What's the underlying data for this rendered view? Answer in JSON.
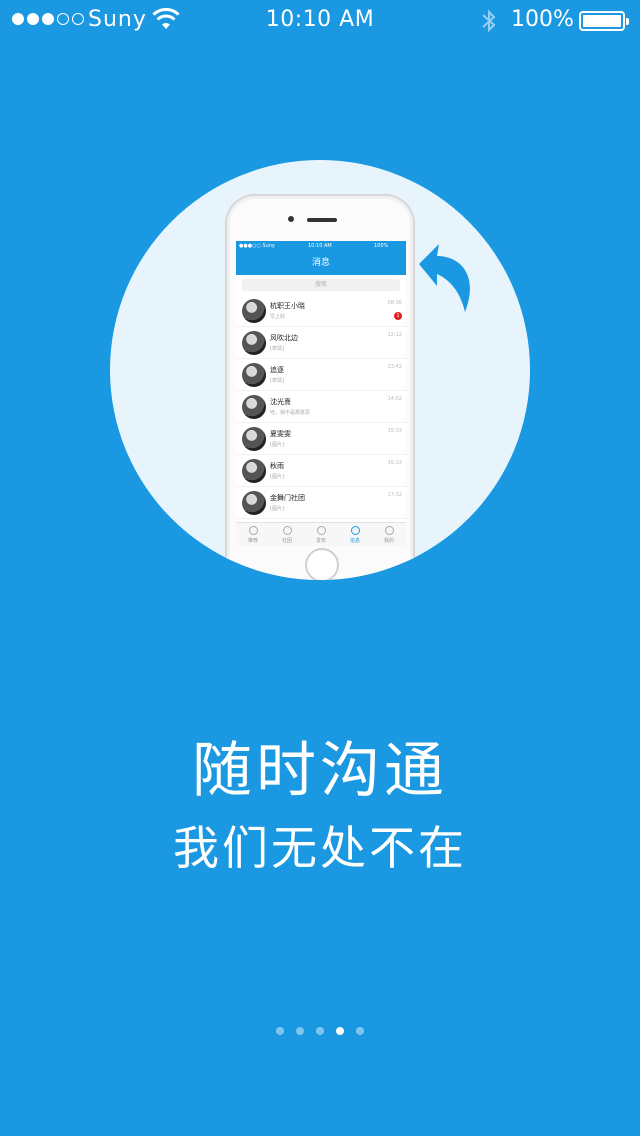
{
  "colors": {
    "background": "#1a98e1",
    "circle": "#e7f4fb",
    "text": "#ffffff",
    "badge": "#e02020"
  },
  "status_bar": {
    "signal_dots_filled": 3,
    "signal_dots_total": 5,
    "carrier": "Suny",
    "time": "10:10 AM",
    "battery_percent": "100%",
    "icons": [
      "wifi-icon",
      "bluetooth-icon",
      "battery-icon"
    ]
  },
  "illustration": {
    "arrow_icon": "curved-back-arrow-icon",
    "mock_screen": {
      "status": {
        "carrier": "●●●○○ Suny",
        "time": "10:10 AM",
        "battery": "100%"
      },
      "title": "消息",
      "search_placeholder": "搜索",
      "chats": [
        {
          "name": "杭职王小晓",
          "message": "早上好",
          "time": "08:36",
          "badge": "1"
        },
        {
          "name": "风吹北边",
          "message": "[表情]",
          "time": "12:12",
          "badge": ""
        },
        {
          "name": "追逐",
          "message": "[表情]",
          "time": "13:42",
          "badge": ""
        },
        {
          "name": "沈光熹",
          "message": "哇，我不是那意思",
          "time": "14:02",
          "badge": ""
        },
        {
          "name": "夏雯雯",
          "message": "[图片]",
          "time": "15:33",
          "badge": ""
        },
        {
          "name": "秋雨",
          "message": "[图片]",
          "time": "16:13",
          "badge": ""
        },
        {
          "name": "金舞门社团",
          "message": "[图片]",
          "time": "17:32",
          "badge": ""
        }
      ],
      "tabs": [
        {
          "label": "推荐",
          "icon": "globe-icon"
        },
        {
          "label": "社团",
          "icon": "plus-circle-icon"
        },
        {
          "label": "发布",
          "icon": "megaphone-icon"
        },
        {
          "label": "信息",
          "icon": "chat-bubble-icon"
        },
        {
          "label": "我的",
          "icon": "person-icon"
        }
      ],
      "active_tab": "信息"
    }
  },
  "headline": "随时沟通",
  "subheadline": "我们无处不在",
  "pager": {
    "total": 5,
    "current": 4
  }
}
